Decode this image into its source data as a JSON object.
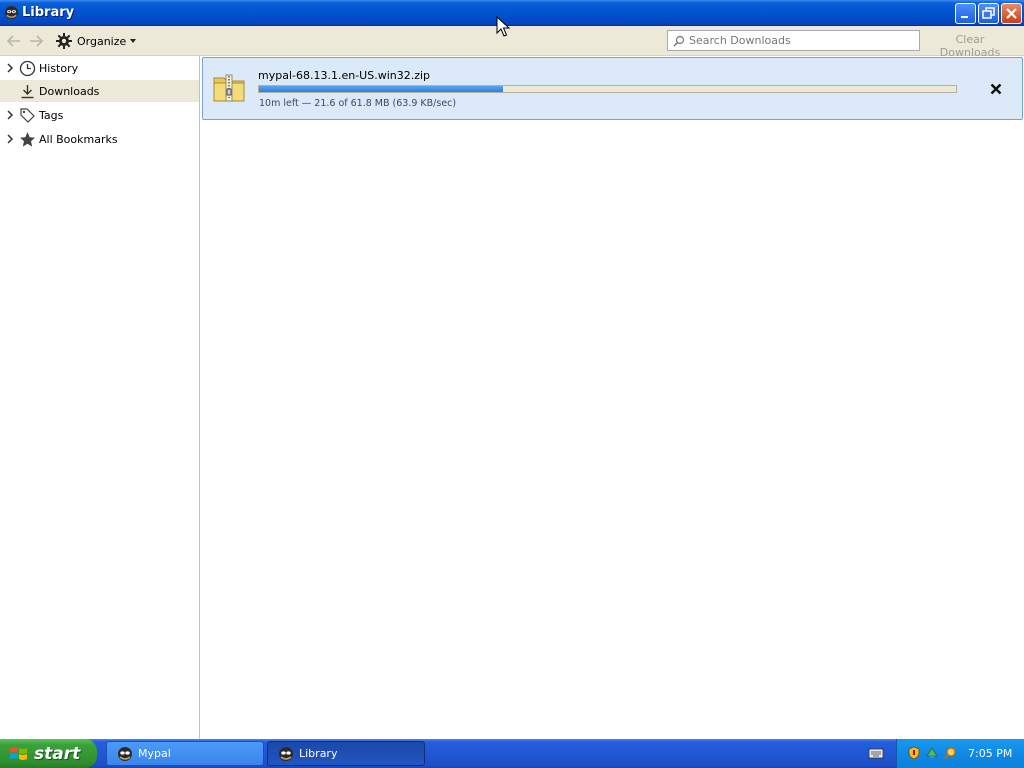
{
  "window": {
    "title": "Library",
    "icon": "mypal-icon"
  },
  "toolbar": {
    "back_icon": "back-arrow-icon",
    "forward_icon": "forward-arrow-icon",
    "organize_label": "Organize",
    "search_placeholder": "Search Downloads",
    "clear_label": "Clear Downloads"
  },
  "sidebar": {
    "items": [
      {
        "label": "History",
        "icon": "clock-icon",
        "expandable": true,
        "selected": false
      },
      {
        "label": "Downloads",
        "icon": "download-arrow-icon",
        "expandable": false,
        "selected": true
      },
      {
        "label": "Tags",
        "icon": "tag-icon",
        "expandable": true,
        "selected": false
      },
      {
        "label": "All Bookmarks",
        "icon": "star-icon",
        "expandable": true,
        "selected": false
      }
    ]
  },
  "downloads": [
    {
      "filename": "mypal-68.13.1.en-US.win32.zip",
      "progress_fraction": 0.35,
      "status": "10m left — 21.6 of 61.8 MB (63.9 KB/sec)",
      "icon": "zip-folder-icon"
    }
  ],
  "taskbar": {
    "start_label": "start",
    "tasks": [
      {
        "label": "Mypal",
        "active": false
      },
      {
        "label": "Library",
        "active": true
      }
    ],
    "clock": "7:05 PM"
  },
  "colors": {
    "titlebar": "#0352d0",
    "progress": "#2b7ee0",
    "download_item_bg": "#dbe9f9",
    "start_green": "#3aa23a"
  }
}
